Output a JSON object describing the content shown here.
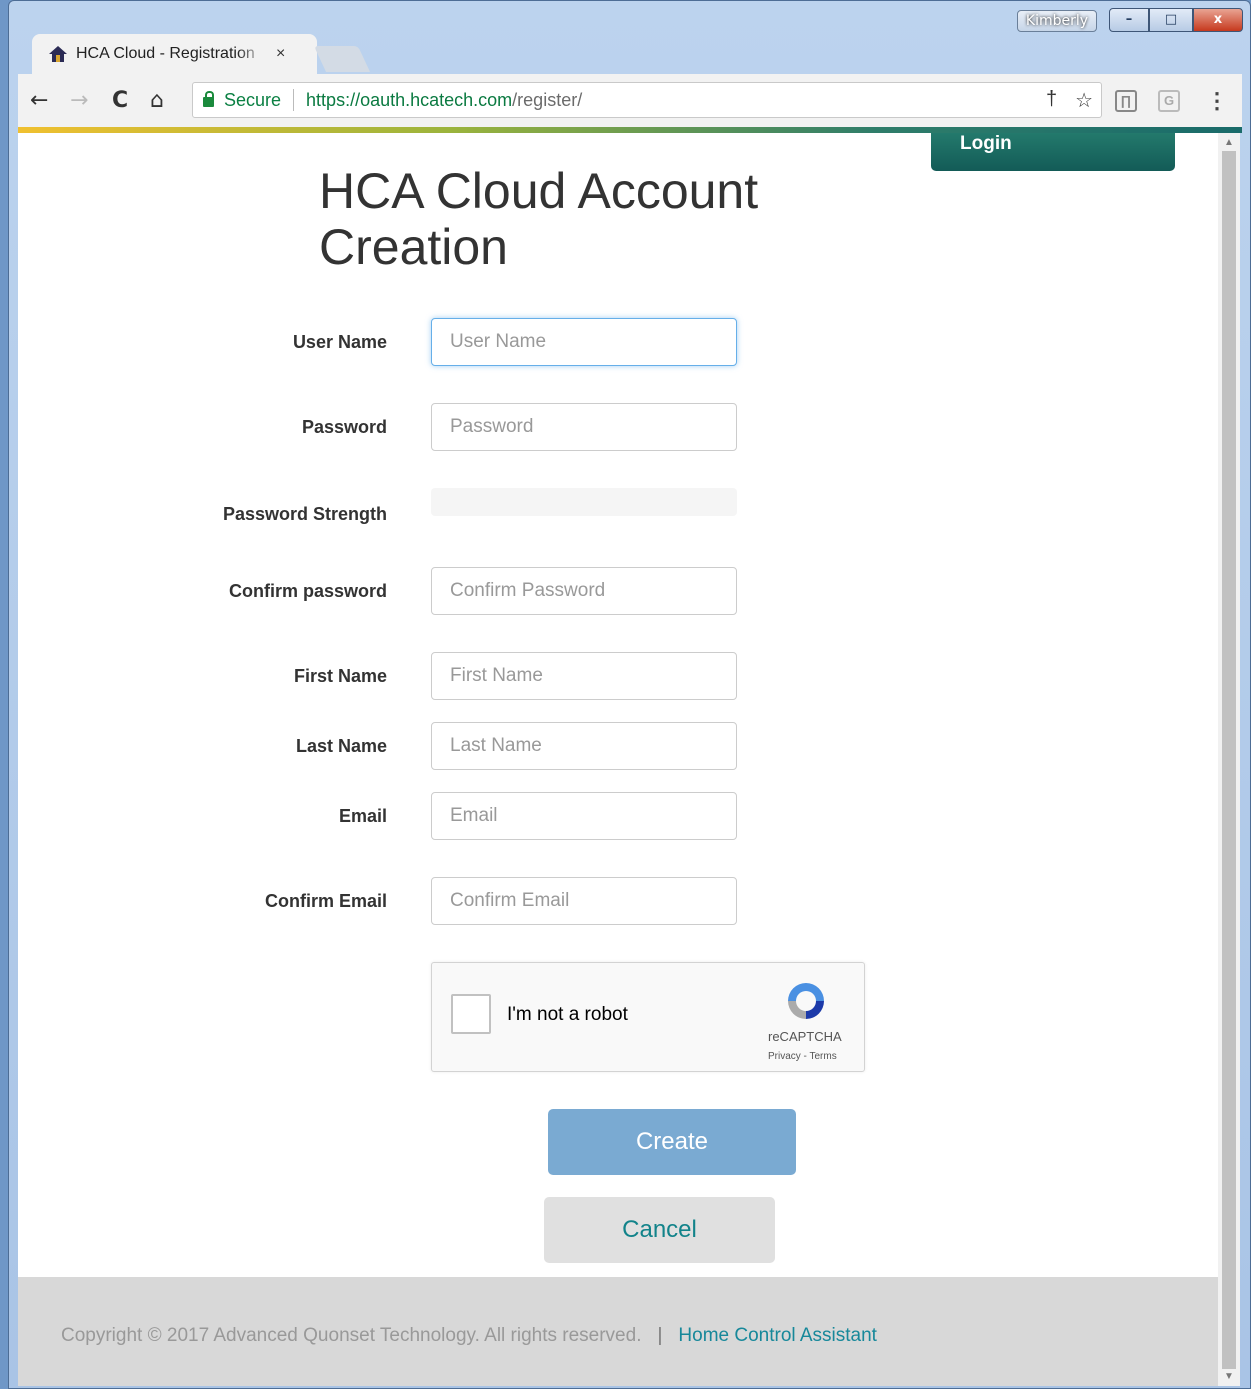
{
  "window": {
    "user_badge": "Kimberly",
    "minimize_label": "–",
    "maximize_label": "□",
    "close_label": "x"
  },
  "tab": {
    "title": "HCA Cloud - Registration",
    "close_label": "×"
  },
  "omnibox": {
    "secure_label": "Secure",
    "url_main": "https://oauth.hcatech.com",
    "url_path": "/register/"
  },
  "nav": {
    "back": "←",
    "forward": "→",
    "reload": "C",
    "home": "⌂",
    "key": "†",
    "star": "☆",
    "ext1": "∏",
    "ext2": "G",
    "menu": "⋮"
  },
  "page": {
    "login_label": "Login",
    "title": "HCA Cloud Account Creation"
  },
  "form": {
    "user_name": {
      "label": "User Name",
      "placeholder": "User Name"
    },
    "password": {
      "label": "Password",
      "placeholder": "Password"
    },
    "password_strength": {
      "label": "Password Strength",
      "value": 0
    },
    "confirm_password": {
      "label": "Confirm password",
      "placeholder": "Confirm Password"
    },
    "first_name": {
      "label": "First Name",
      "placeholder": "First Name"
    },
    "last_name": {
      "label": "Last Name",
      "placeholder": "Last Name"
    },
    "email": {
      "label": "Email",
      "placeholder": "Email"
    },
    "confirm_email": {
      "label": "Confirm Email",
      "placeholder": "Confirm Email"
    }
  },
  "captcha": {
    "label": "I'm not a robot",
    "brand": "reCAPTCHA",
    "links": "Privacy - Terms"
  },
  "buttons": {
    "create": "Create",
    "cancel": "Cancel"
  },
  "footer": {
    "copyright": "Copyright © 2017 Advanced Quonset Technology. All rights reserved.",
    "separator": "|",
    "link": "Home Control Assistant"
  },
  "colors": {
    "login_bg": "#1a6a62",
    "create_bg": "#7aaad2",
    "cancel_text": "#12838a",
    "footer_link": "#17889a",
    "secure_green": "#0b8043"
  }
}
